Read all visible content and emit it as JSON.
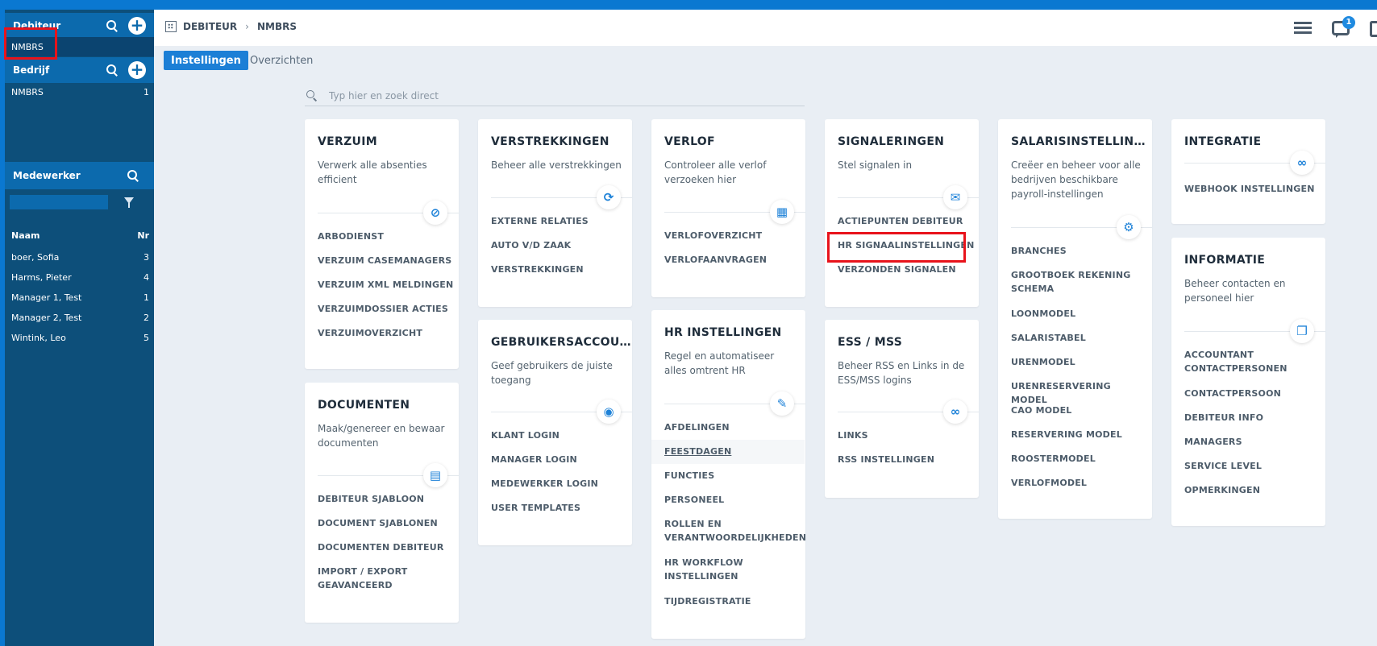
{
  "sidebar": {
    "debiteur": {
      "title": "Debiteur",
      "selected_item": "NMBRS"
    },
    "bedrijf": {
      "title": "Bedrijf",
      "items": [
        {
          "label": "NMBRS",
          "num": "1"
        }
      ]
    },
    "medewerker": {
      "title": "Medewerker",
      "columns": {
        "name": "Naam",
        "nr": "Nr"
      },
      "rows": [
        {
          "name": "boer, Sofia",
          "nr": "3"
        },
        {
          "name": "Harms, Pieter",
          "nr": "4"
        },
        {
          "name": "Manager 1, Test",
          "nr": "1"
        },
        {
          "name": "Manager 2, Test",
          "nr": "2"
        },
        {
          "name": "Wintink, Leo",
          "nr": "5"
        }
      ]
    }
  },
  "header": {
    "breadcrumb": [
      "DEBITEUR",
      "NMBRS"
    ],
    "chat_badge": "1"
  },
  "tabs": [
    "Instellingen",
    "Overzichten"
  ],
  "search": {
    "placeholder": "Typ hier en zoek direct"
  },
  "cards": {
    "verzuim": {
      "title": "VERZUIM",
      "desc": "Verwerk alle absenties efficient",
      "icon": "eye-off-icon",
      "links": [
        "ARBODIENST",
        "VERZUIM CASEMANAGERS",
        "VERZUIM XML MELDINGEN",
        "VERZUIMDOSSIER ACTIES",
        "VERZUIMOVERZICHT"
      ]
    },
    "documenten": {
      "title": "DOCUMENTEN",
      "desc": "Maak/genereer en bewaar documenten",
      "icon": "document-icon",
      "links": [
        "DEBITEUR SJABLOON",
        "DOCUMENT SJABLONEN",
        "DOCUMENTEN DEBITEUR",
        "IMPORT / EXPORT GEAVANCEERD"
      ]
    },
    "verstrekkingen": {
      "title": "VERSTREKKINGEN",
      "desc": "Beheer alle verstrekkingen",
      "icon": "sync-icon",
      "links": [
        "EXTERNE RELATIES",
        "AUTO V/D ZAAK",
        "VERSTREKKINGEN"
      ]
    },
    "gebruikers": {
      "title": "GEBRUIKERSACCOUNTS",
      "desc": "Geef gebruikers de juiste toegang",
      "icon": "user-circle-icon",
      "links": [
        "KLANT LOGIN",
        "MANAGER LOGIN",
        "MEDEWERKER LOGIN",
        "USER TEMPLATES"
      ]
    },
    "verlof": {
      "title": "VERLOF",
      "desc": "Controleer alle verlof verzoeken hier",
      "icon": "calendar-icon",
      "links": [
        "VERLOFOVERZICHT",
        "VERLOFAANVRAGEN"
      ]
    },
    "hr": {
      "title": "HR INSTELLINGEN",
      "desc": "Regel en automatiseer alles omtrent HR",
      "icon": "wrench-icon",
      "links": [
        "AFDELINGEN",
        "FEESTDAGEN",
        "FUNCTIES",
        "PERSONEEL",
        "ROLLEN EN VERANTWOORDELIJKHEDEN",
        "HR WORKFLOW INSTELLINGEN",
        "TIJDREGISTRATIE"
      ]
    },
    "signaleringen": {
      "title": "SIGNALERINGEN",
      "desc": "Stel signalen in",
      "icon": "envelope-icon",
      "links": [
        "ACTIEPUNTEN DEBITEUR",
        "HR SIGNAALINSTELLINGEN",
        "VERZONDEN SIGNALEN"
      ]
    },
    "ess": {
      "title": "ESS / MSS",
      "desc": "Beheer RSS en Links in de ESS/MSS logins",
      "icon": "link-icon",
      "links": [
        "LINKS",
        "RSS INSTELLINGEN"
      ]
    },
    "salaris": {
      "title": "SALARISINSTELLINGEN",
      "desc": "Creëer en beheer voor alle bedrijven beschikbare payroll-instellingen",
      "icon": "gear-icon",
      "links": [
        "BRANCHES",
        "GROOTBOEK REKENING SCHEMA",
        "LOONMODEL",
        "SALARISTABEL",
        "URENMODEL",
        "URENRESERVERING MODEL",
        "CAO MODEL",
        "RESERVERING MODEL",
        "ROOSTERMODEL",
        "VERLOFMODEL"
      ]
    },
    "integratie": {
      "title": "INTEGRATIE",
      "icon": "link-icon",
      "links": [
        "WEBHOOK INSTELLINGEN"
      ]
    },
    "informatie": {
      "title": "INFORMATIE",
      "desc": "Beheer contacten en personeel hier",
      "icon": "book-icon",
      "links": [
        "ACCOUNTANT CONTACTPERSONEN",
        "CONTACTPERSOON",
        "DEBITEUR INFO",
        "MANAGERS",
        "SERVICE LEVEL",
        "OPMERKINGEN"
      ]
    }
  }
}
